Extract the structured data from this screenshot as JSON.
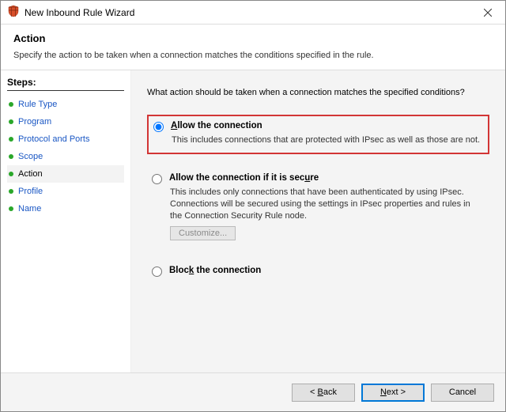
{
  "window": {
    "title": "New Inbound Rule Wizard"
  },
  "header": {
    "title": "Action",
    "subtitle": "Specify the action to be taken when a connection matches the conditions specified in the rule."
  },
  "sidebar": {
    "heading": "Steps:",
    "items": [
      {
        "label": "Rule Type",
        "current": false
      },
      {
        "label": "Program",
        "current": false
      },
      {
        "label": "Protocol and Ports",
        "current": false
      },
      {
        "label": "Scope",
        "current": false
      },
      {
        "label": "Action",
        "current": true
      },
      {
        "label": "Profile",
        "current": false
      },
      {
        "label": "Name",
        "current": false
      }
    ]
  },
  "main": {
    "question": "What action should be taken when a connection matches the specified conditions?",
    "options": {
      "allow": {
        "mnemonic": "A",
        "rest": "llow the connection",
        "desc": "This includes connections that are protected with IPsec as well as those are not.",
        "checked": true
      },
      "allow_secure": {
        "pre": "Allow the connection if it is sec",
        "mnemonic": "u",
        "post": "re",
        "desc": "This includes only connections that have been authenticated by using IPsec. Connections will be secured using the settings in IPsec properties and rules in the Connection Security Rule node.",
        "customize_label": "Customize...",
        "checked": false
      },
      "block": {
        "pre": "Bloc",
        "mnemonic": "k",
        "post": " the connection",
        "checked": false
      }
    }
  },
  "footer": {
    "back_pre": "< ",
    "back_m": "B",
    "back_post": "ack",
    "next_m": "N",
    "next_post": "ext >",
    "cancel": "Cancel"
  }
}
